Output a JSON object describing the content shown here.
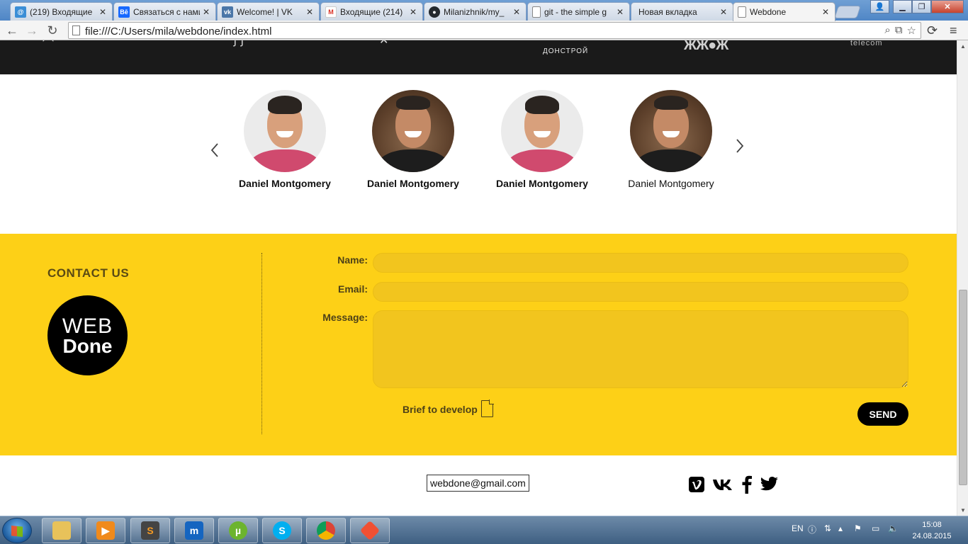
{
  "browser": {
    "tabs": [
      {
        "label": "(219) Входящие",
        "icon": "email-icon",
        "color": "#3b8ed6"
      },
      {
        "label": "Связаться с нами",
        "icon": "behance-icon",
        "color": "#1769ff"
      },
      {
        "label": "Welcome! | VK",
        "icon": "vk-icon",
        "color": "#4a76a8"
      },
      {
        "label": "Входящие (214)",
        "icon": "gmail-icon",
        "color": "#d93025"
      },
      {
        "label": "Milanizhnik/my_",
        "icon": "github-icon",
        "color": "#24292e"
      },
      {
        "label": "git - the simple g",
        "icon": "page-icon",
        "color": "#ffffff"
      },
      {
        "label": "Новая вкладка",
        "icon": "blank-icon",
        "color": "#ffffff"
      },
      {
        "label": "Webdone",
        "icon": "page-icon",
        "color": "#ffffff"
      }
    ],
    "url": "file:///C:/Users/mila/webdone/index.html"
  },
  "partners": {
    "donstroy": "ДОНСТРОЙ",
    "mark2": "telecom"
  },
  "team": {
    "members": [
      {
        "name": "Daniel Montgomery",
        "photo": "person-pink-shirt"
      },
      {
        "name": "Daniel Montgomery",
        "photo": "person-dark-shirt"
      },
      {
        "name": "Daniel Montgomery",
        "photo": "person-pink-shirt"
      },
      {
        "name": "Daniel Montgomery",
        "photo": "person-dark-shirt"
      }
    ]
  },
  "contact": {
    "title": "CONTACT US",
    "logo_line1": "WEB",
    "logo_line2": "Done",
    "name_label": "Name:",
    "email_label": "Email:",
    "message_label": "Message:",
    "name_value": "",
    "email_value": "",
    "message_value": "",
    "brief_label": "Brief to develop",
    "send_label": "SEND",
    "accent_color": "#fdd017"
  },
  "footer": {
    "email": "webdone@gmail.com",
    "social": [
      "vimeo-icon",
      "vk-icon",
      "facebook-icon",
      "twitter-icon"
    ]
  },
  "taskbar": {
    "lang": "EN",
    "time": "15:08",
    "date": "24.08.2015",
    "apps": [
      "explorer-icon",
      "media-player-icon",
      "sublime-text-icon",
      "maxthon-icon",
      "utorrent-icon",
      "skype-icon",
      "chrome-icon",
      "git-icon"
    ]
  }
}
